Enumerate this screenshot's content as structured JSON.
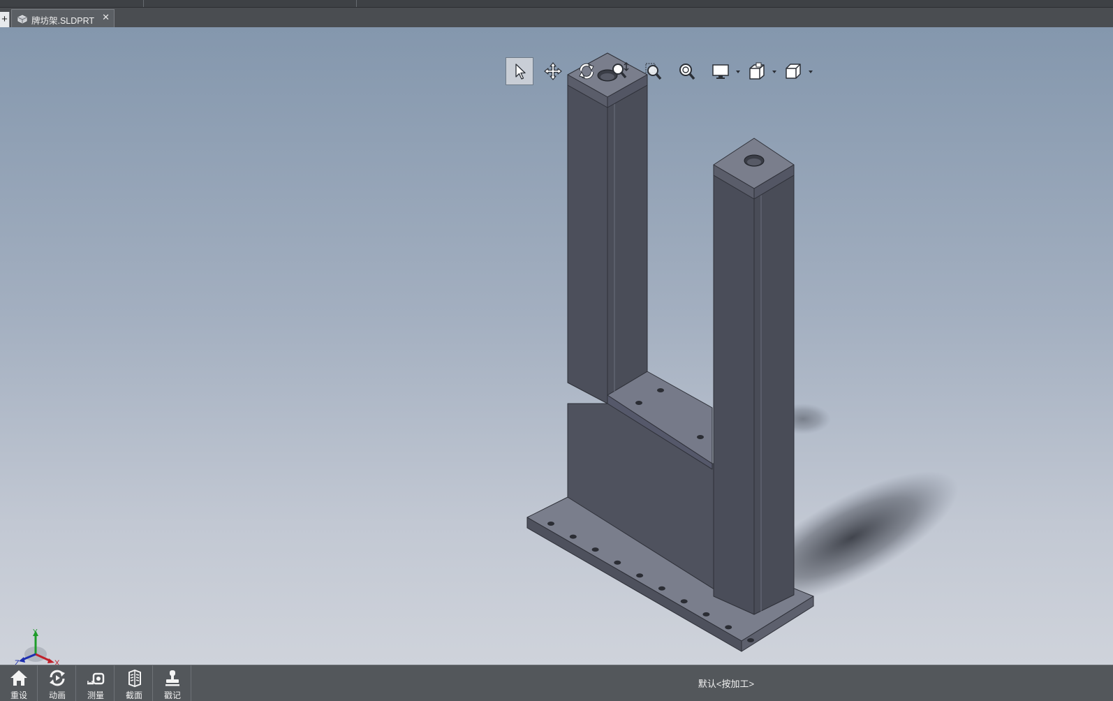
{
  "tabs": {
    "new_tab_symbol": "+",
    "document_tab": {
      "label": "牌坊架.SLDPRT",
      "close_symbol": "✕",
      "icon": "part-icon"
    }
  },
  "view_toolbar": {
    "buttons": [
      {
        "name": "select-tool",
        "icon": "arrow-cursor-icon",
        "active": true
      },
      {
        "name": "pan-tool",
        "icon": "move-arrows-icon",
        "active": false
      },
      {
        "name": "rotate-tool",
        "icon": "rotate-icon",
        "active": false
      },
      {
        "name": "zoom-in-out-tool",
        "icon": "zoom-in-out-icon",
        "active": false
      },
      {
        "name": "zoom-to-area-tool",
        "icon": "zoom-area-icon",
        "active": false
      },
      {
        "name": "zoom-to-fit-tool",
        "icon": "zoom-fit-icon",
        "active": false
      },
      {
        "name": "display-style-menu",
        "icon": "monitor-icon",
        "active": false,
        "has_dropdown": true
      },
      {
        "name": "view-orientation-menu",
        "icon": "view-cube-icon",
        "active": false,
        "has_dropdown": true
      },
      {
        "name": "standard-views-menu",
        "icon": "wire-cube-icon",
        "active": false,
        "has_dropdown": true
      }
    ]
  },
  "triad": {
    "x_label": "X",
    "y_label": "Y",
    "z_label": "Z"
  },
  "bottom_bar": {
    "buttons": [
      {
        "label": "重设",
        "icon": "home-icon"
      },
      {
        "label": "动画",
        "icon": "animate-icon"
      },
      {
        "label": "测量",
        "icon": "measure-icon"
      },
      {
        "label": "截面",
        "icon": "section-icon"
      },
      {
        "label": "戳记",
        "icon": "stamp-icon"
      }
    ],
    "configuration_status": "默认<按加工>"
  },
  "colors": {
    "viewport_top": "#8497ad",
    "viewport_bottom": "#cfd3db",
    "model_face_dark": "#4e515d",
    "model_face_light": "#7a7e8c",
    "bar_background": "#53575b"
  }
}
